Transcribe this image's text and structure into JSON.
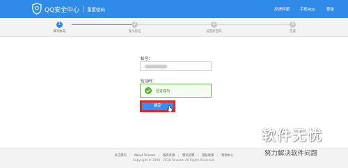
{
  "header": {
    "logo_text": "QQ安全中心",
    "page_name": "重置密码",
    "links": {
      "feedback": "反馈问题",
      "mobile_app": "手机App",
      "login": "登录"
    },
    "brand_color": "#2f8ae8"
  },
  "steps": [
    {
      "number": "1",
      "label": "填写帐号",
      "state": "active"
    },
    {
      "number": "2",
      "label": "身份验证",
      "state": "inactive"
    },
    {
      "number": "3",
      "label": "设置新密码",
      "state": "inactive"
    },
    {
      "number": "4",
      "label": "完成",
      "state": "inactive"
    }
  ],
  "form": {
    "account_label": "帐号：",
    "code_label": "验证码：",
    "verify_status": "验证成功",
    "confirm_label": "确定",
    "success_color": "#6dbd54",
    "highlight_color": "#e0281e"
  },
  "footer": {
    "links": [
      "关于腾讯",
      "About Tencent",
      "服务条款",
      "腾讯招聘",
      "隐私政策",
      "帮助中心"
    ],
    "copyright": "Copyright © 1998 - 2018 Tencent. All Rights Reserved."
  },
  "watermark": {
    "title": "软件无忧",
    "subtitle": "努力解决软件问题"
  }
}
